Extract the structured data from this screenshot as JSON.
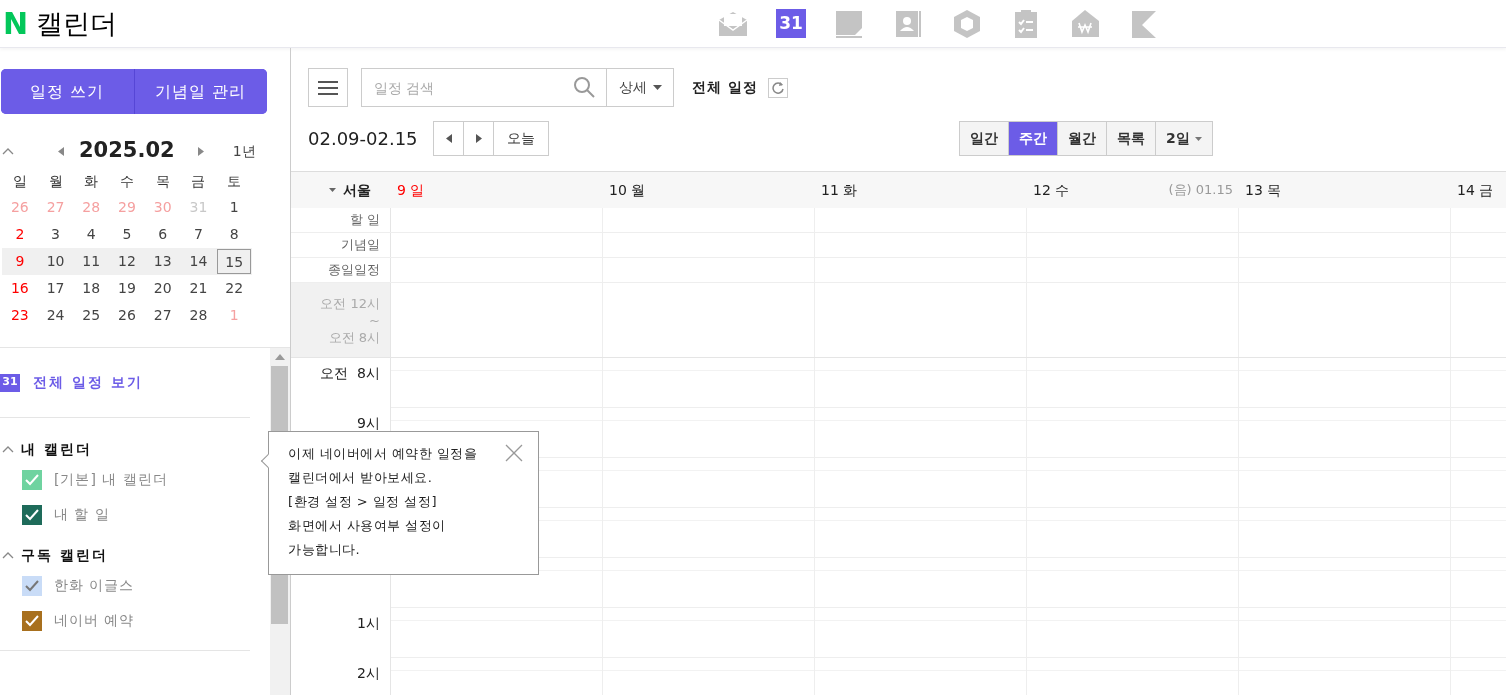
{
  "logo": {
    "mark": "N",
    "title": "캘린더"
  },
  "app_icons": [
    {
      "kind": "mail",
      "selected": false
    },
    {
      "kind": "calendar",
      "label": "31",
      "selected": true
    },
    {
      "kind": "memo",
      "selected": false
    },
    {
      "kind": "contacts",
      "selected": false
    },
    {
      "kind": "box",
      "selected": false
    },
    {
      "kind": "tasks",
      "selected": false
    },
    {
      "kind": "money",
      "selected": false
    },
    {
      "kind": "bookmark",
      "selected": false
    }
  ],
  "sidebar": {
    "buttons": [
      "일정 쓰기",
      "기념일 관리"
    ],
    "mini_calendar": {
      "month": "2025.02",
      "year_link": "1년",
      "weekdays": [
        "일",
        "월",
        "화",
        "수",
        "목",
        "금",
        "토"
      ],
      "weeks": [
        {
          "selected": false,
          "days": [
            {
              "label": "26",
              "muted": true,
              "holiday": true
            },
            {
              "label": "27",
              "muted": true,
              "holiday": true
            },
            {
              "label": "28",
              "muted": true,
              "holiday": true
            },
            {
              "label": "29",
              "muted": true,
              "holiday": true
            },
            {
              "label": "30",
              "muted": true,
              "holiday": true
            },
            {
              "label": "31",
              "muted": true,
              "holiday": false
            },
            {
              "label": "1",
              "muted": false,
              "holiday": false
            }
          ]
        },
        {
          "selected": false,
          "days": [
            {
              "label": "2",
              "muted": false,
              "holiday": true
            },
            {
              "label": "3",
              "muted": false,
              "holiday": false
            },
            {
              "label": "4",
              "muted": false,
              "holiday": false
            },
            {
              "label": "5",
              "muted": false,
              "holiday": false
            },
            {
              "label": "6",
              "muted": false,
              "holiday": false
            },
            {
              "label": "7",
              "muted": false,
              "holiday": false
            },
            {
              "label": "8",
              "muted": false,
              "holiday": false
            }
          ]
        },
        {
          "selected": true,
          "days": [
            {
              "label": "9",
              "muted": false,
              "holiday": true
            },
            {
              "label": "10",
              "muted": false,
              "holiday": false
            },
            {
              "label": "11",
              "muted": false,
              "holiday": false
            },
            {
              "label": "12",
              "muted": false,
              "holiday": false
            },
            {
              "label": "13",
              "muted": false,
              "holiday": false
            },
            {
              "label": "14",
              "muted": false,
              "holiday": false
            },
            {
              "label": "15",
              "muted": false,
              "holiday": false,
              "today": true
            }
          ]
        },
        {
          "selected": false,
          "days": [
            {
              "label": "16",
              "muted": false,
              "holiday": true
            },
            {
              "label": "17",
              "muted": false,
              "holiday": false
            },
            {
              "label": "18",
              "muted": false,
              "holiday": false
            },
            {
              "label": "19",
              "muted": false,
              "holiday": false
            },
            {
              "label": "20",
              "muted": false,
              "holiday": false
            },
            {
              "label": "21",
              "muted": false,
              "holiday": false
            },
            {
              "label": "22",
              "muted": false,
              "holiday": false
            }
          ]
        },
        {
          "selected": false,
          "days": [
            {
              "label": "23",
              "muted": false,
              "holiday": true
            },
            {
              "label": "24",
              "muted": false,
              "holiday": false
            },
            {
              "label": "25",
              "muted": false,
              "holiday": false
            },
            {
              "label": "26",
              "muted": false,
              "holiday": false
            },
            {
              "label": "27",
              "muted": false,
              "holiday": false
            },
            {
              "label": "28",
              "muted": false,
              "holiday": false
            },
            {
              "label": "1",
              "muted": true,
              "holiday": true
            }
          ]
        }
      ]
    },
    "all_link": {
      "icon_label": "31",
      "label": "전체 일정 보기"
    },
    "groups": [
      {
        "title": "내 캘린더",
        "expanded": true,
        "items": [
          {
            "label": "[기본] 내 캘린더",
            "checked": true,
            "color": "#6fd3a0"
          },
          {
            "label": "내 할 일",
            "checked": true,
            "color": "#1e6b5a"
          }
        ]
      },
      {
        "title": "구독 캘린더",
        "expanded": true,
        "items": [
          {
            "label": "한화 이글스",
            "checked": true,
            "color": "#c9dcf7"
          },
          {
            "label": "네이버 예약",
            "checked": true,
            "color": "#a8701e"
          }
        ]
      }
    ]
  },
  "toolbar": {
    "search_placeholder": "일정 검색",
    "detail": "상세",
    "filter": "전체 일정",
    "range": "02.09-02.15",
    "today": "오늘",
    "views": [
      {
        "label": "일간",
        "selected": false
      },
      {
        "label": "주간",
        "selected": true
      },
      {
        "label": "월간",
        "selected": false
      },
      {
        "label": "목록",
        "selected": false
      },
      {
        "label": "2일",
        "selected": false,
        "dropdown": true
      }
    ]
  },
  "week": {
    "timezone": "서울",
    "days": [
      {
        "label": "9 일",
        "holiday": true
      },
      {
        "label": "10 월",
        "holiday": false
      },
      {
        "label": "11 화",
        "holiday": false
      },
      {
        "label": "12 수",
        "holiday": false,
        "lunar": "(음) 01.15"
      },
      {
        "label": "13 목",
        "holiday": false
      },
      {
        "label": "14 금",
        "holiday": false
      }
    ],
    "allday_rows": [
      "할 일",
      "기념일",
      "종일일정"
    ],
    "collapsed": [
      "오전 12시",
      "~",
      "오전 8시"
    ],
    "hours_above_tooltip": [
      "오전  8시",
      "9시"
    ],
    "hours_below_tooltip": [
      "1시",
      "2시"
    ]
  },
  "tooltip": {
    "lines": [
      "이제 네이버에서 예약한 일정을",
      "캘린더에서 받아보세요.",
      "[환경 설정 > 일정 설정]",
      "화면에서 사용여부 설정이",
      "가능합니다."
    ]
  }
}
